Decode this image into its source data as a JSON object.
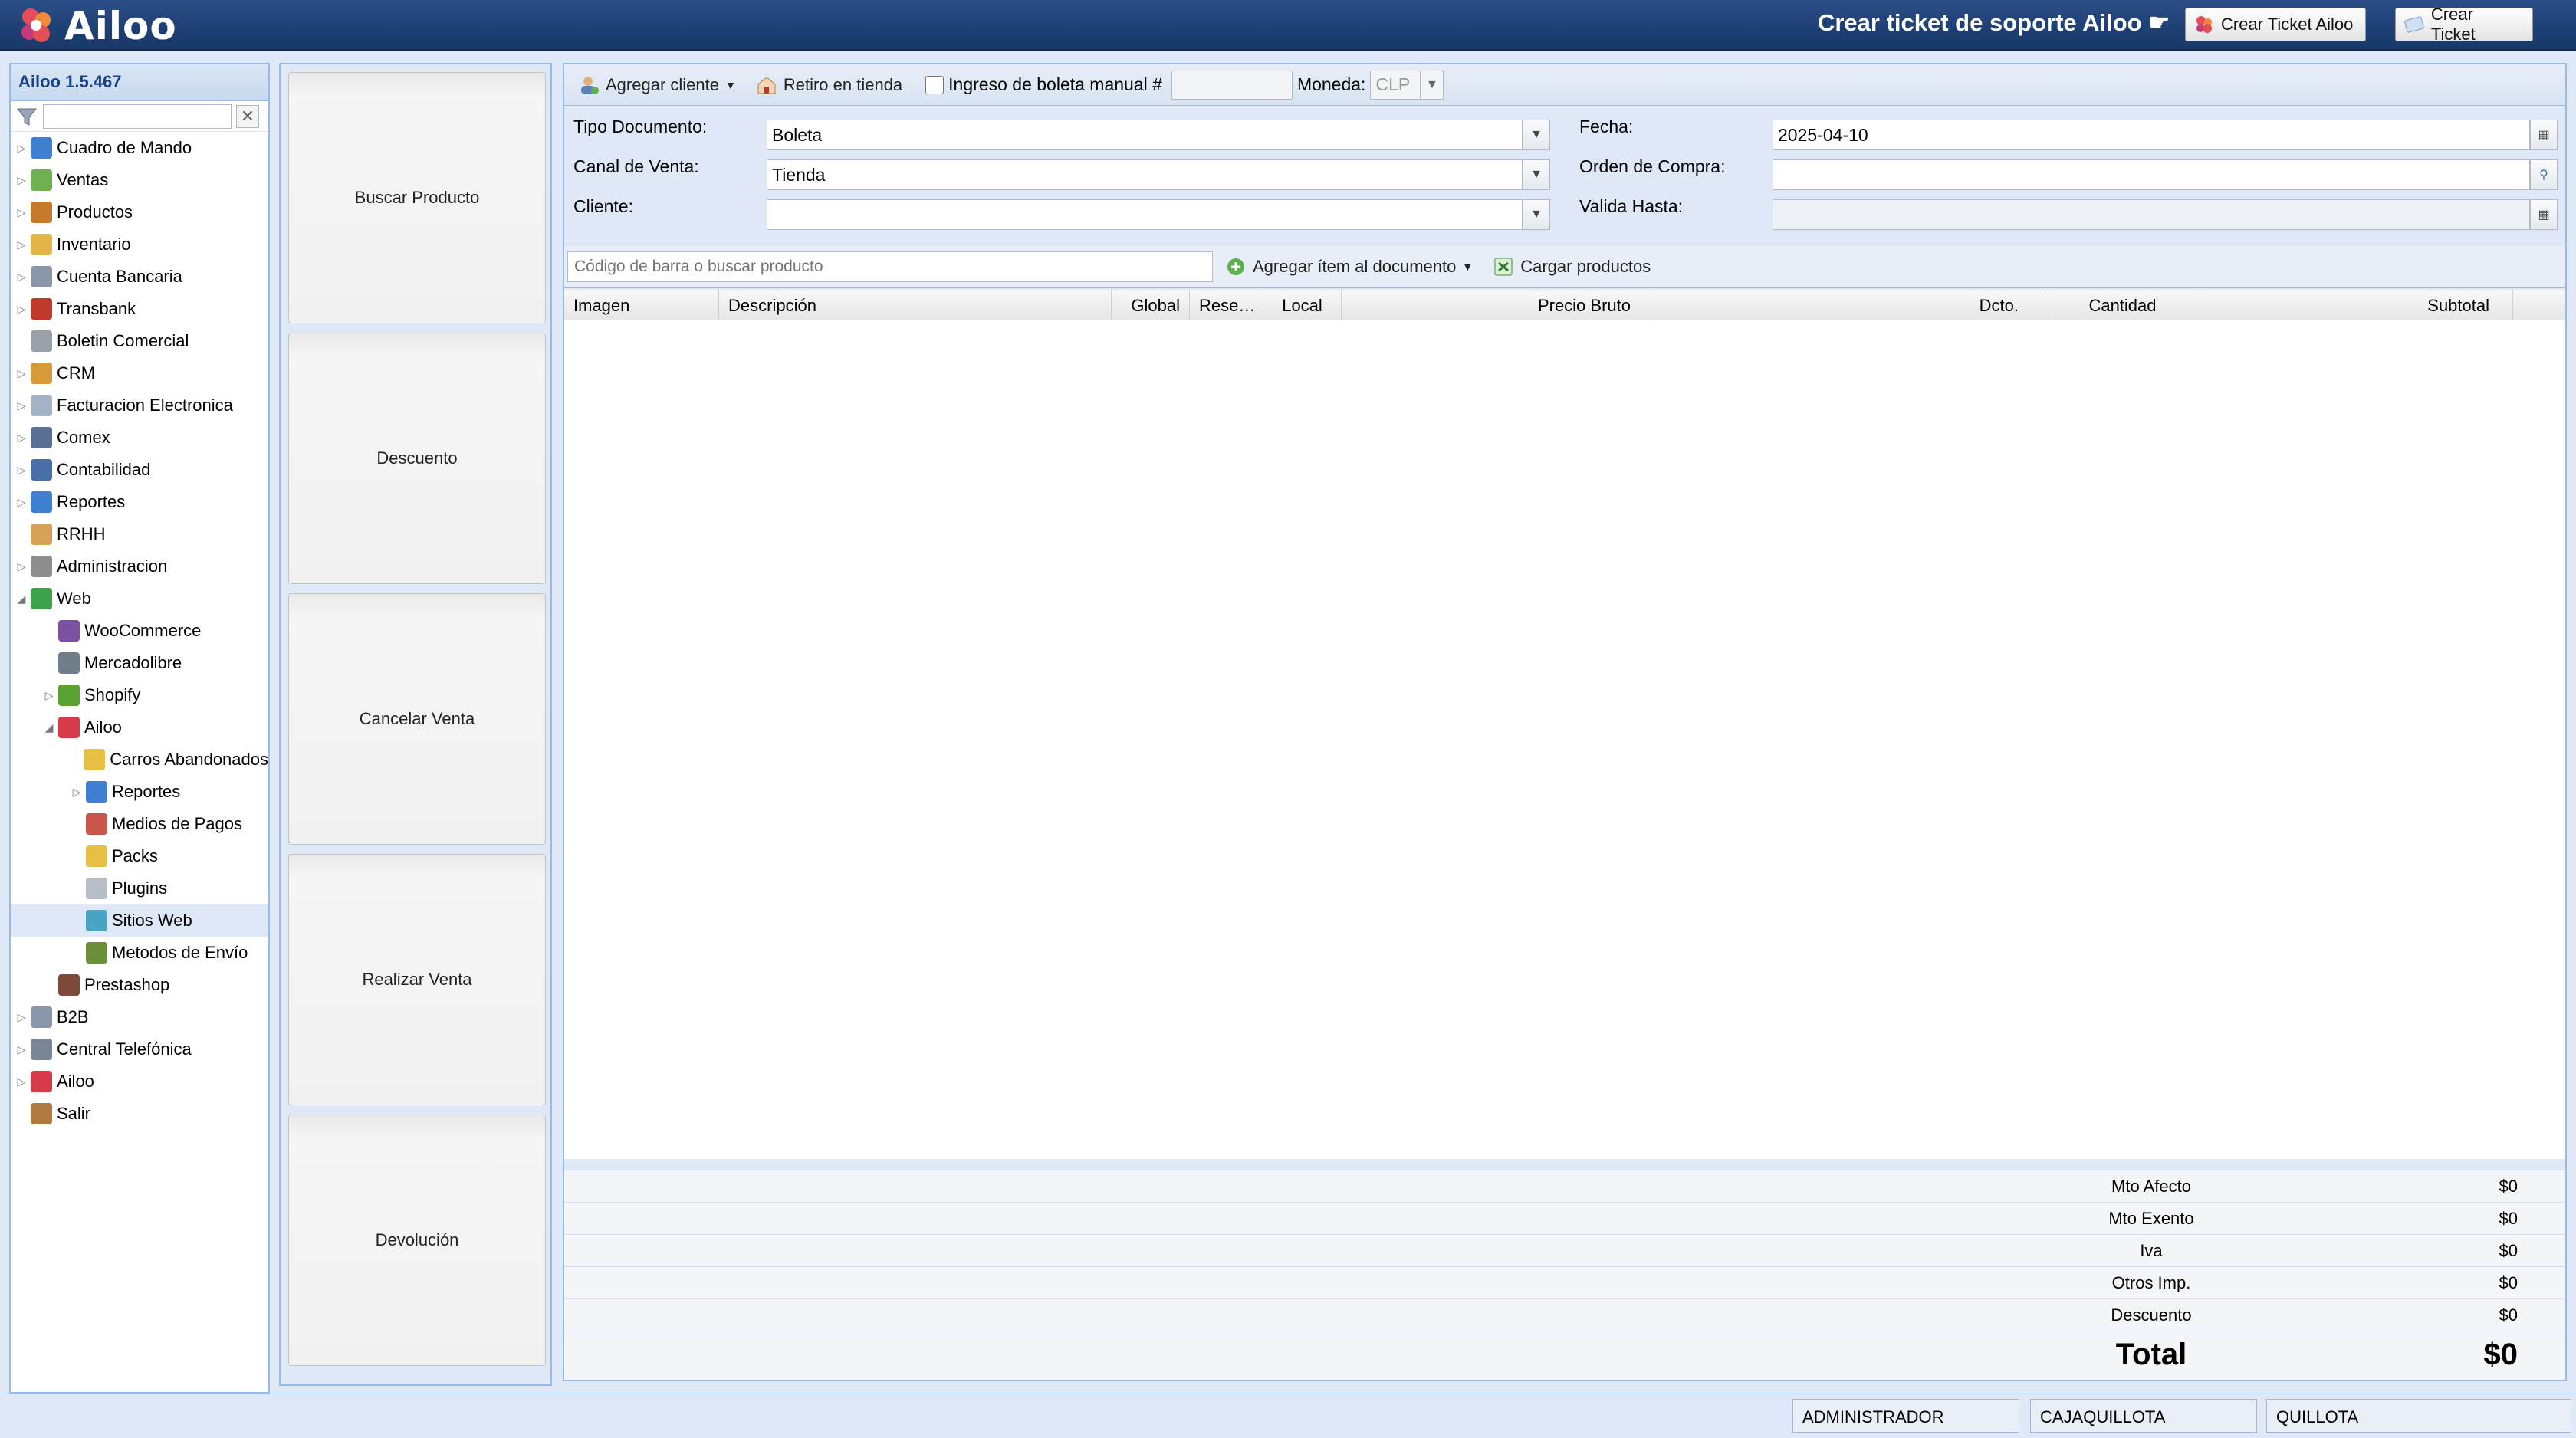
{
  "header": {
    "logo_text": "Ailoo",
    "support_title": "Crear ticket de soporte Ailoo ☛",
    "btn_ticket_ailoo": "Crear Ticket Ailoo",
    "btn_ticket": "Crear Ticket"
  },
  "nav": {
    "version": "Ailoo 1.5.467",
    "clear_symbol": "✕",
    "items": [
      {
        "label": "Cuadro de Mando",
        "level": 0,
        "exp": "▷",
        "color": "#3f7fd1"
      },
      {
        "label": "Ventas",
        "level": 0,
        "exp": "▷",
        "color": "#6fb050"
      },
      {
        "label": "Productos",
        "level": 0,
        "exp": "▷",
        "color": "#c77a2c"
      },
      {
        "label": "Inventario",
        "level": 0,
        "exp": "▷",
        "color": "#e3b449"
      },
      {
        "label": "Cuenta Bancaria",
        "level": 0,
        "exp": "▷",
        "color": "#8a97ab"
      },
      {
        "label": "Transbank",
        "level": 0,
        "exp": "▷",
        "color": "#c0392b"
      },
      {
        "label": "Boletin Comercial",
        "level": 0,
        "exp": "",
        "color": "#9aa0a8"
      },
      {
        "label": "CRM",
        "level": 0,
        "exp": "▷",
        "color": "#d79a3a"
      },
      {
        "label": "Facturacion Electronica",
        "level": 0,
        "exp": "▷",
        "color": "#a4b2c6"
      },
      {
        "label": "Comex",
        "level": 0,
        "exp": "▷",
        "color": "#5a6f94"
      },
      {
        "label": "Contabilidad",
        "level": 0,
        "exp": "▷",
        "color": "#4a6fa8"
      },
      {
        "label": "Reportes",
        "level": 0,
        "exp": "▷",
        "color": "#3f7fd1"
      },
      {
        "label": "RRHH",
        "level": 0,
        "exp": "",
        "color": "#d7a257"
      },
      {
        "label": "Administracion",
        "level": 0,
        "exp": "▷",
        "color": "#8e8e8e"
      },
      {
        "label": "Web",
        "level": 0,
        "exp": "◢",
        "color": "#3da34a"
      },
      {
        "label": "WooCommerce",
        "level": 1,
        "exp": "",
        "color": "#7b51a3"
      },
      {
        "label": "Mercadolibre",
        "level": 1,
        "exp": "",
        "color": "#6f7e8a"
      },
      {
        "label": "Shopify",
        "level": 1,
        "exp": "▷",
        "color": "#5aa332"
      },
      {
        "label": "Ailoo",
        "level": 1,
        "exp": "◢",
        "color": "#d63b4a"
      },
      {
        "label": "Carros Abandonados",
        "level": 2,
        "exp": "",
        "color": "#e8bf45"
      },
      {
        "label": "Reportes",
        "level": 2,
        "exp": "▷",
        "color": "#3f7fd1"
      },
      {
        "label": "Medios de Pagos",
        "level": 2,
        "exp": "",
        "color": "#c9554b"
      },
      {
        "label": "Packs",
        "level": 2,
        "exp": "",
        "color": "#e8bf45"
      },
      {
        "label": "Plugins",
        "level": 2,
        "exp": "",
        "color": "#b8bec7"
      },
      {
        "label": "Sitios Web",
        "level": 2,
        "exp": "",
        "color": "#4aa5c4",
        "selected": true
      },
      {
        "label": "Metodos de Envío",
        "level": 2,
        "exp": "",
        "color": "#6b8f3a"
      },
      {
        "label": "Prestashop",
        "level": 1,
        "exp": "",
        "color": "#7d4a3a"
      },
      {
        "label": "B2B",
        "level": 0,
        "exp": "▷",
        "color": "#8a97ab"
      },
      {
        "label": "Central Telefónica",
        "level": 0,
        "exp": "▷",
        "color": "#7a8596"
      },
      {
        "label": "Ailoo",
        "level": 0,
        "exp": "▷",
        "color": "#d63b4a"
      },
      {
        "label": "Salir",
        "level": 0,
        "exp": "",
        "color": "#b07a3f"
      }
    ]
  },
  "actions": [
    {
      "label": "Buscar Producto",
      "name": "buscar-producto-button"
    },
    {
      "label": "Descuento",
      "name": "descuento-button"
    },
    {
      "label": "Cancelar Venta",
      "name": "cancelar-venta-button"
    },
    {
      "label": "Realizar Venta",
      "name": "realizar-venta-button"
    },
    {
      "label": "Devolución",
      "name": "devolucion-button"
    }
  ],
  "toolbar": {
    "add_client": "Agregar cliente",
    "retiro": "Retiro en tienda",
    "manual_boleta": "Ingreso de boleta manual #",
    "moneda_label": "Moneda:",
    "moneda_value": "CLP"
  },
  "form": {
    "tipo_label": "Tipo Documento:",
    "tipo_value": "Boleta",
    "canal_label": "Canal de Venta:",
    "canal_value": "Tienda",
    "cliente_label": "Cliente:",
    "cliente_value": "",
    "fecha_label": "Fecha:",
    "fecha_value": "2025-04-10",
    "orden_label": "Orden de Compra:",
    "orden_value": "",
    "valida_label": "Valida Hasta:",
    "valida_value": ""
  },
  "items_toolbar": {
    "search_placeholder": "Código de barra o buscar producto",
    "add_item": "Agregar ítem al documento",
    "load_products": "Cargar productos"
  },
  "grid": {
    "columns": [
      "Imagen",
      "Descripción",
      "Global",
      "Rese…",
      "Local",
      "Precio Bruto",
      "Dcto.",
      "Cantidad",
      "Subtotal"
    ]
  },
  "totals": {
    "rows": [
      {
        "label": "Mto Afecto",
        "value": "$0"
      },
      {
        "label": "Mto Exento",
        "value": "$0"
      },
      {
        "label": "Iva",
        "value": "$0"
      },
      {
        "label": "Otros Imp.",
        "value": "$0"
      },
      {
        "label": "Descuento",
        "value": "$0"
      }
    ],
    "total_label": "Total",
    "total_value": "$0"
  },
  "status": {
    "user": "ADMINISTRADOR",
    "caja": "CAJAQUILLOTA",
    "sucursal": "QUILLOTA"
  }
}
